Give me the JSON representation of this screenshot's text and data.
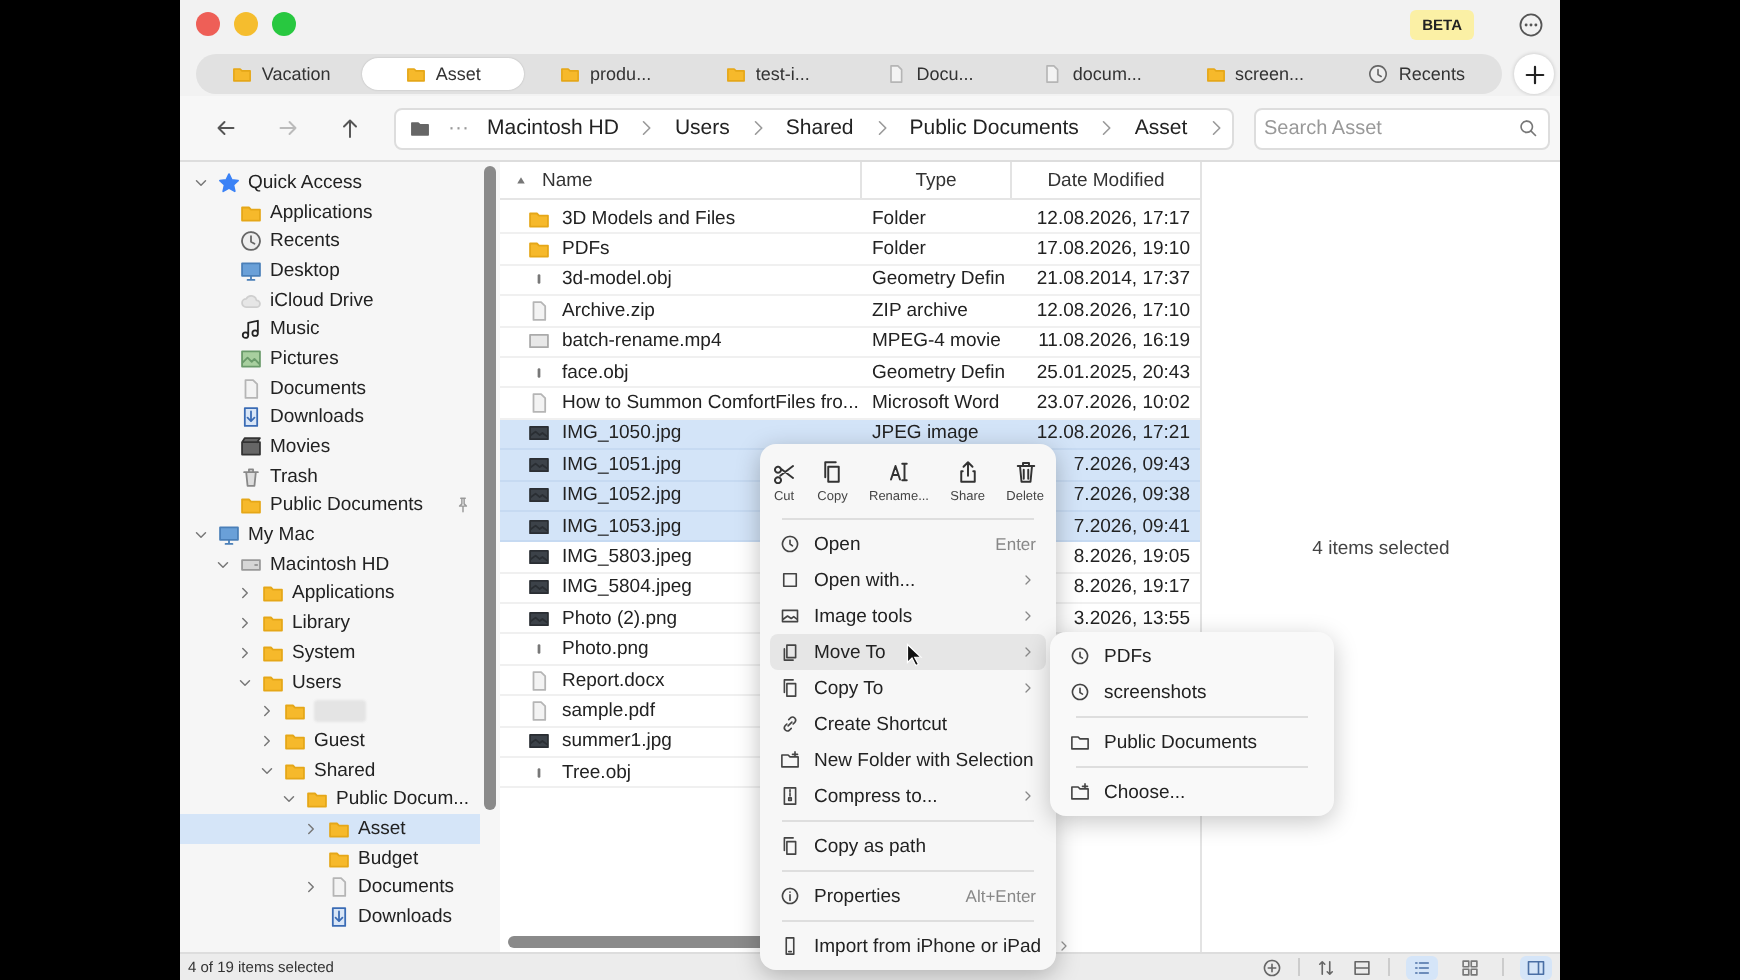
{
  "titlebar": {
    "badge": "BETA"
  },
  "tabs": [
    {
      "label": "Vacation",
      "kind": "folder",
      "selected": false
    },
    {
      "label": "Asset",
      "kind": "folder",
      "selected": true
    },
    {
      "label": "produ...",
      "kind": "folder",
      "selected": false
    },
    {
      "label": "test-i...",
      "kind": "folder",
      "selected": false
    },
    {
      "label": "Docu...",
      "kind": "file",
      "selected": false
    },
    {
      "label": "docum...",
      "kind": "file",
      "selected": false
    },
    {
      "label": "screen...",
      "kind": "folder",
      "selected": false
    },
    {
      "label": "Recents",
      "kind": "clock",
      "selected": false
    }
  ],
  "toolbar": {
    "back": {
      "disabled": false
    },
    "forward": {
      "disabled": true
    },
    "up": {
      "disabled": false
    },
    "breadcrumb": {
      "overflow": "···",
      "items": [
        "Macintosh HD",
        "Users",
        "Shared",
        "Public Documents",
        "Asset"
      ]
    },
    "search": {
      "placeholder": "Search Asset"
    }
  },
  "sidebar": [
    {
      "label": "Quick Access",
      "kind": "star",
      "expanded": true,
      "selected": false,
      "children": [
        {
          "label": "Applications",
          "kind": "folder",
          "selected": false,
          "pinned": false
        },
        {
          "label": "Recents",
          "kind": "clock",
          "selected": false,
          "pinned": false
        },
        {
          "label": "Desktop",
          "kind": "desktop",
          "selected": false,
          "pinned": false
        },
        {
          "label": "iCloud Drive",
          "kind": "cloud",
          "selected": false,
          "pinned": false
        },
        {
          "label": "Music",
          "kind": "music",
          "selected": false,
          "pinned": false
        },
        {
          "label": "Pictures",
          "kind": "pictures",
          "selected": false,
          "pinned": false
        },
        {
          "label": "Documents",
          "kind": "file",
          "selected": false,
          "pinned": false
        },
        {
          "label": "Downloads",
          "kind": "download",
          "selected": false,
          "pinned": false
        },
        {
          "label": "Movies",
          "kind": "movie",
          "selected": false,
          "pinned": false
        },
        {
          "label": "Trash",
          "kind": "trash",
          "selected": false,
          "pinned": false
        },
        {
          "label": "Public Documents",
          "kind": "folder",
          "selected": false,
          "pinned": true
        }
      ]
    },
    {
      "label": "My Mac",
      "kind": "desktop",
      "expanded": true,
      "selected": false,
      "children": [
        {
          "label": "Macintosh HD",
          "kind": "drive",
          "expanded": true,
          "selected": false,
          "children": [
            {
              "label": "Applications",
              "kind": "folder",
              "expanded": false,
              "selected": false
            },
            {
              "label": "Library",
              "kind": "folder",
              "expanded": false,
              "selected": false
            },
            {
              "label": "System",
              "kind": "folder",
              "expanded": false,
              "selected": false
            },
            {
              "label": "Users",
              "kind": "folder",
              "expanded": true,
              "selected": false,
              "children": [
                {
                  "kind": "folder",
                  "redacted": true,
                  "expanded": false,
                  "selected": false
                },
                {
                  "label": "Guest",
                  "kind": "folder",
                  "expanded": false,
                  "selected": false
                },
                {
                  "label": "Shared",
                  "kind": "folder",
                  "expanded": true,
                  "selected": false,
                  "children": [
                    {
                      "label": "Public Docum...",
                      "kind": "folder",
                      "expanded": true,
                      "selected": false,
                      "children": [
                        {
                          "label": "Asset",
                          "kind": "folder",
                          "expanded": false,
                          "selected": true
                        },
                        {
                          "label": "Budget",
                          "kind": "folder",
                          "selected": false
                        },
                        {
                          "label": "Documents",
                          "kind": "file",
                          "expanded": false,
                          "selected": false
                        },
                        {
                          "label": "Downloads",
                          "kind": "download",
                          "selected": false
                        }
                      ]
                    }
                  ]
                }
              ]
            }
          ]
        }
      ]
    }
  ],
  "table": {
    "columns": [
      "Name",
      "Type",
      "Date Modified"
    ],
    "rows": [
      {
        "name": "3D Models and Files",
        "kind": "folder",
        "type": "Folder",
        "date": "12.08.2026, 17:17",
        "selected": false
      },
      {
        "name": "PDFs",
        "kind": "folder",
        "type": "Folder",
        "date": "17.08.2026, 19:10",
        "selected": false
      },
      {
        "name": "3d-model.obj",
        "kind": "object",
        "type": "Geometry Defin",
        "date": "21.08.2014, 17:37",
        "selected": false
      },
      {
        "name": "Archive.zip",
        "kind": "file",
        "type": "ZIP archive",
        "date": "12.08.2026, 17:10",
        "selected": false
      },
      {
        "name": "batch-rename.mp4",
        "kind": "video",
        "type": "MPEG-4 movie",
        "date": "11.08.2026, 16:19",
        "selected": false
      },
      {
        "name": "face.obj",
        "kind": "object",
        "type": "Geometry Defin",
        "date": "25.01.2025, 20:43",
        "selected": false
      },
      {
        "name": "How to Summon ComfortFiles fro...",
        "kind": "file",
        "type": "Microsoft Word",
        "date": "23.07.2026, 10:02",
        "selected": false
      },
      {
        "name": "IMG_1050.jpg",
        "kind": "image",
        "type": "JPEG image",
        "date": "12.08.2026, 17:21",
        "selected": true
      },
      {
        "name": "IMG_1051.jpg",
        "kind": "image",
        "date": "7.2026, 09:43",
        "selected": true
      },
      {
        "name": "IMG_1052.jpg",
        "kind": "image",
        "date": "7.2026, 09:38",
        "selected": true
      },
      {
        "name": "IMG_1053.jpg",
        "kind": "image",
        "date": "7.2026, 09:41",
        "selected": true
      },
      {
        "name": "IMG_5803.jpeg",
        "kind": "image",
        "date": "8.2026, 19:05",
        "selected": false
      },
      {
        "name": "IMG_5804.jpeg",
        "kind": "image",
        "date": "8.2026, 19:17",
        "selected": false
      },
      {
        "name": "Photo (2).png",
        "kind": "image",
        "date": "3.2026, 13:55",
        "selected": false
      },
      {
        "name": "Photo.png",
        "kind": "object",
        "selected": false
      },
      {
        "name": "Report.docx",
        "kind": "file",
        "selected": false
      },
      {
        "name": "sample.pdf",
        "kind": "file",
        "selected": false
      },
      {
        "name": "summer1.jpg",
        "kind": "image",
        "selected": false
      },
      {
        "name": "Tree.obj",
        "kind": "object",
        "selected": false
      }
    ]
  },
  "preview": {
    "text": "4 items selected"
  },
  "status_bar": {
    "text": "4 of 19 items selected",
    "view_buttons": [
      {
        "selected": true
      },
      {
        "selected": false
      }
    ],
    "preview_toggle": {
      "on": true
    }
  },
  "context_menu": {
    "actions": [
      "Cut",
      "Copy",
      "Rename...",
      "Share",
      "Delete"
    ],
    "groups": [
      [
        {
          "label": "Open",
          "shortcut": "Enter",
          "submenu": false,
          "selected": false
        },
        {
          "label": "Open with...",
          "submenu": true,
          "selected": false
        },
        {
          "label": "Image tools",
          "submenu": true,
          "selected": false
        },
        {
          "label": "Move To",
          "submenu": true,
          "selected": true
        },
        {
          "label": "Copy To",
          "submenu": true,
          "selected": false
        },
        {
          "label": "Create Shortcut",
          "submenu": false,
          "selected": false
        },
        {
          "label": "New Folder with Selection",
          "submenu": false,
          "selected": false
        },
        {
          "label": "Compress to...",
          "submenu": true,
          "selected": false
        }
      ],
      [
        {
          "label": "Copy as path",
          "submenu": false,
          "selected": false
        }
      ],
      [
        {
          "label": "Properties",
          "shortcut": "Alt+Enter",
          "submenu": false,
          "selected": false
        }
      ],
      [
        {
          "label": "Import from iPhone or iPad",
          "submenu": true,
          "selected": false
        }
      ]
    ]
  },
  "submenu": {
    "groups": [
      [
        {
          "label": "PDFs",
          "kind": "recent"
        },
        {
          "label": "screenshots",
          "kind": "recent"
        }
      ],
      [
        {
          "label": "Public Documents",
          "kind": "folder"
        }
      ],
      [
        {
          "label": "Choose...",
          "kind": "choose"
        }
      ]
    ]
  }
}
